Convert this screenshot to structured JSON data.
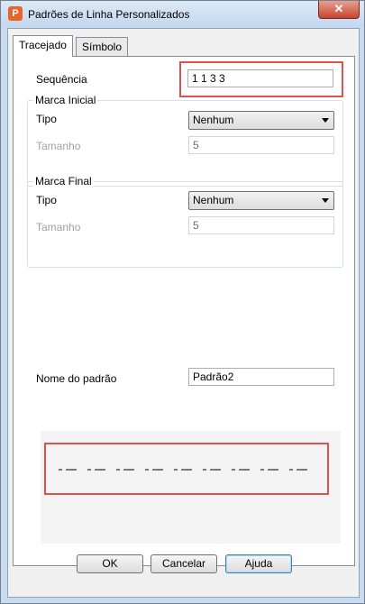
{
  "window": {
    "title": "Padrões de Linha Personalizados",
    "app_icon_letter": "P",
    "close_glyph": "✕"
  },
  "tabs": [
    {
      "label": "Tracejado"
    },
    {
      "label": "Símbolo"
    }
  ],
  "sequence": {
    "label": "Sequência",
    "value": "1 1 3 3"
  },
  "start_mark": {
    "group_title": "Marca Inicial",
    "type_label": "Tipo",
    "type_value": "Nenhum",
    "size_label": "Tamanho",
    "size_value": "5"
  },
  "end_mark": {
    "group_title": "Marca Final",
    "type_label": "Tipo",
    "type_value": "Nenhum",
    "size_label": "Tamanho",
    "size_value": "5"
  },
  "pattern_name": {
    "label": "Nome do padrão",
    "value": "Padrão2"
  },
  "preview": {
    "dash_pattern": [
      1,
      1,
      3,
      3
    ],
    "color": "#000000"
  },
  "buttons": {
    "ok": "OK",
    "cancel": "Cancelar",
    "help": "Ajuda"
  },
  "colors": {
    "highlight": "#d9534f",
    "title_bar": "#c9dbee"
  }
}
